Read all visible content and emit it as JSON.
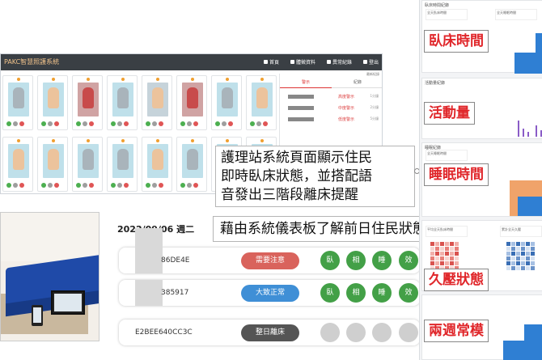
{
  "station": {
    "title": "PAKC智慧照護系統",
    "nav": [
      "首頁",
      "體徵資料",
      "異常紀錄",
      "登出"
    ],
    "alert_tabs": [
      "警示",
      "紀錄"
    ],
    "alert_legend": "最新紀錄",
    "alerts": [
      {
        "level": "高度警示",
        "ago": "1分鐘"
      },
      {
        "level": "中度警示",
        "ago": "2分鐘"
      },
      {
        "level": "低度警示",
        "ago": "5分鐘"
      }
    ]
  },
  "callouts": {
    "station_line1": "護理站系統頁面顯示住民",
    "station_line2": "即時臥床狀態，並搭配語",
    "station_line3": "音發出三階段離床提醒",
    "dashboard": "藉由系統儀表板了解前日住民狀態"
  },
  "records": {
    "date": "2022/09/06 週二",
    "rows": [
      {
        "id": "86DE4E",
        "status": "需要注意",
        "status_color": "#d9635c",
        "buttons": [
          "臥",
          "相",
          "睡",
          "效"
        ],
        "active": true
      },
      {
        "id": "385917",
        "status": "大致正常",
        "status_color": "#3f8fd6",
        "buttons": [
          "臥",
          "相",
          "睡",
          "效"
        ],
        "active": true
      },
      {
        "id": "E2BEE640CC3C",
        "status": "整日離床",
        "status_color": "#555555",
        "buttons": [
          "",
          "",
          "",
          ""
        ],
        "active": false
      }
    ]
  },
  "right": {
    "panel1_title": "臥床時間紀錄",
    "panel2_title": "活動量紀錄",
    "panel3_title": "睡眠紀錄",
    "labels": {
      "bed_time": "臥床時間",
      "activity": "活動量",
      "sleep": "睡眠時間",
      "pressure": "久壓狀態",
      "two_week": "兩週常模"
    },
    "stat1": "全天臥床時間",
    "stat2": "全天睡眠時間",
    "stat3": "平均全天臥床時間",
    "stat4": "累計全天久壓"
  },
  "colors": {
    "alert_red": "#e0262a",
    "need_attention": "#d9635c",
    "normal_blue": "#3f8fd6",
    "off_bed_grey": "#555555",
    "button_green": "#43a047",
    "chart_blue": "#2f7fd3"
  }
}
